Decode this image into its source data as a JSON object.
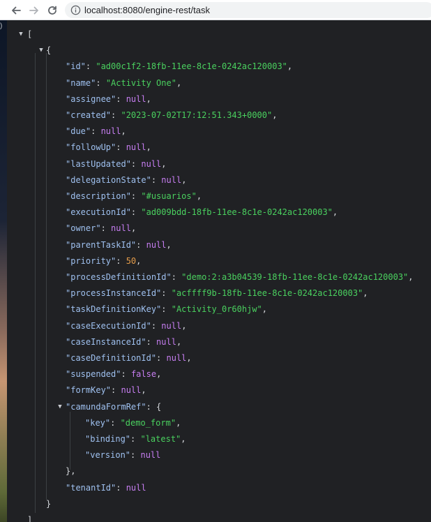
{
  "browser": {
    "url": "localhost:8080/engine-rest/task",
    "back_icon": "arrow-left-icon",
    "forward_icon": "arrow-right-icon",
    "reload_icon": "reload-icon",
    "info_icon": "info-icon"
  },
  "edge_text": ")",
  "colors": {
    "background": "#202124",
    "key": "#9fc1f0",
    "string": "#4ad15f",
    "number": "#e59c4a",
    "literal": "#c77ef2",
    "punctuation": "#d5d8dc"
  },
  "json": {
    "open_array": "[",
    "close_array": "]",
    "open_object": "{",
    "close_object": "}",
    "fields": [
      {
        "key": "\"id\"",
        "value": "\"ad00c1f2-18fb-11ee-8c1e-0242ac120003\"",
        "type": "string",
        "sep": ","
      },
      {
        "key": "\"name\"",
        "value": "\"Activity One\"",
        "type": "string",
        "sep": ","
      },
      {
        "key": "\"assignee\"",
        "value": "null",
        "type": "literal",
        "sep": ","
      },
      {
        "key": "\"created\"",
        "value": "\"2023-07-02T17:12:51.343+0000\"",
        "type": "string",
        "sep": ","
      },
      {
        "key": "\"due\"",
        "value": "null",
        "type": "literal",
        "sep": ","
      },
      {
        "key": "\"followUp\"",
        "value": "null",
        "type": "literal",
        "sep": ","
      },
      {
        "key": "\"lastUpdated\"",
        "value": "null",
        "type": "literal",
        "sep": ","
      },
      {
        "key": "\"delegationState\"",
        "value": "null",
        "type": "literal",
        "sep": ","
      },
      {
        "key": "\"description\"",
        "value": "\"#usuarios\"",
        "type": "string",
        "sep": ","
      },
      {
        "key": "\"executionId\"",
        "value": "\"ad009bdd-18fb-11ee-8c1e-0242ac120003\"",
        "type": "string",
        "sep": ","
      },
      {
        "key": "\"owner\"",
        "value": "null",
        "type": "literal",
        "sep": ","
      },
      {
        "key": "\"parentTaskId\"",
        "value": "null",
        "type": "literal",
        "sep": ","
      },
      {
        "key": "\"priority\"",
        "value": "50",
        "type": "number",
        "sep": ","
      },
      {
        "key": "\"processDefinitionId\"",
        "value": "\"demo:2:a3b04539-18fb-11ee-8c1e-0242ac120003\"",
        "type": "string",
        "sep": ","
      },
      {
        "key": "\"processInstanceId\"",
        "value": "\"acffff9b-18fb-11ee-8c1e-0242ac120003\"",
        "type": "string",
        "sep": ","
      },
      {
        "key": "\"taskDefinitionKey\"",
        "value": "\"Activity_0r60hjw\"",
        "type": "string",
        "sep": ","
      },
      {
        "key": "\"caseExecutionId\"",
        "value": "null",
        "type": "literal",
        "sep": ","
      },
      {
        "key": "\"caseInstanceId\"",
        "value": "null",
        "type": "literal",
        "sep": ","
      },
      {
        "key": "\"caseDefinitionId\"",
        "value": "null",
        "type": "literal",
        "sep": ","
      },
      {
        "key": "\"suspended\"",
        "value": "false",
        "type": "literal",
        "sep": ","
      },
      {
        "key": "\"formKey\"",
        "value": "null",
        "type": "literal",
        "sep": ","
      }
    ],
    "camundaFormRef": {
      "key": "\"camundaFormRef\"",
      "open": "{",
      "close": "},",
      "fields": [
        {
          "key": "\"key\"",
          "value": "\"demo_form\"",
          "type": "string",
          "sep": ","
        },
        {
          "key": "\"binding\"",
          "value": "\"latest\"",
          "type": "string",
          "sep": ","
        },
        {
          "key": "\"version\"",
          "value": "null",
          "type": "literal",
          "sep": ""
        }
      ]
    },
    "tenantId": {
      "key": "\"tenantId\"",
      "value": "null",
      "type": "literal",
      "sep": ""
    }
  }
}
